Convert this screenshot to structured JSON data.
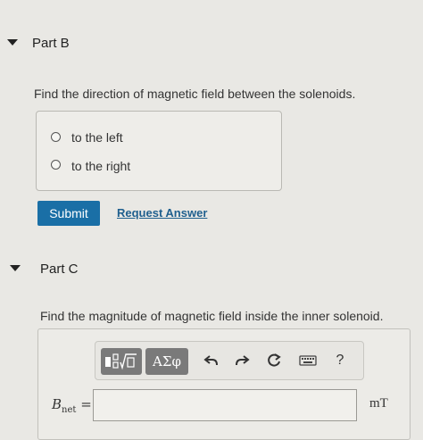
{
  "partB": {
    "title": "Part B",
    "question": "Find the direction of magnetic field between the solenoids.",
    "choices": [
      {
        "label": "to the left"
      },
      {
        "label": "to the right"
      }
    ],
    "submit_label": "Submit",
    "request_answer_label": "Request Answer"
  },
  "partC": {
    "title": "Part C",
    "question": "Find the magnitude of magnetic field inside the inner solenoid.",
    "toolbar": {
      "greek_label": "ΑΣφ",
      "help_label": "?"
    },
    "variable": {
      "symbol": "B",
      "subscript": "net",
      "equals": "="
    },
    "input_value": "",
    "unit": "mT"
  },
  "colors": {
    "accent": "#1a6fa6",
    "link": "#1f5f8e",
    "background": "#e9e8e4"
  },
  "icons": [
    "collapse-caret-icon",
    "templates-icon",
    "undo-icon",
    "redo-icon",
    "reset-icon",
    "keyboard-icon",
    "help-icon"
  ]
}
